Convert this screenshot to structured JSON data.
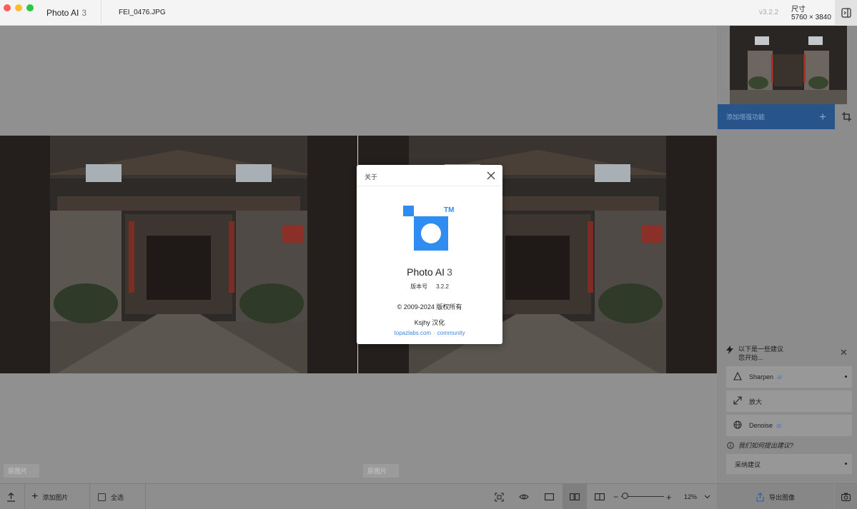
{
  "titlebar": {
    "app_name": "Photo AI",
    "app_version_short": "3",
    "file_name": "FEI_0476.JPG",
    "version": "v3.2.2",
    "size_label": "尺寸",
    "size_value": "5760 × 3840"
  },
  "canvas": {
    "left_tag": "原图片",
    "right_tag": "原图片"
  },
  "sidebar": {
    "add_enhancement": "添加增强功能",
    "suggestions_title_1": "以下是一些建议",
    "suggestions_title_2": "您开始...",
    "items": [
      {
        "label": "Sharpen",
        "badge": "ai",
        "icon": "triangle-icon"
      },
      {
        "label": "放大",
        "badge": "",
        "icon": "expand-arrows-icon"
      },
      {
        "label": "Denoise",
        "badge": "ai",
        "icon": "globe-icon"
      }
    ],
    "how_suggest": "我们如何提出建议?",
    "accept": "采纳建议"
  },
  "bottombar": {
    "add_image": "添加图片",
    "select_all": "全选",
    "zoom": "12%",
    "export": "导出图像"
  },
  "about": {
    "title": "关于",
    "tm": "TM",
    "product": "Photo AI",
    "product_version": "3",
    "version_label": "版本号",
    "version_value": "3.2.2",
    "copyright": "© 2009-2024 版权所有",
    "credit": "Ksjhy 汉化",
    "link1": "topazlabs.com",
    "link_sep": "·",
    "link2": "community"
  },
  "colors": {
    "brand_blue": "#2f8cf0",
    "link_blue": "#3f86e0",
    "enhance_bar": "#27548a"
  }
}
